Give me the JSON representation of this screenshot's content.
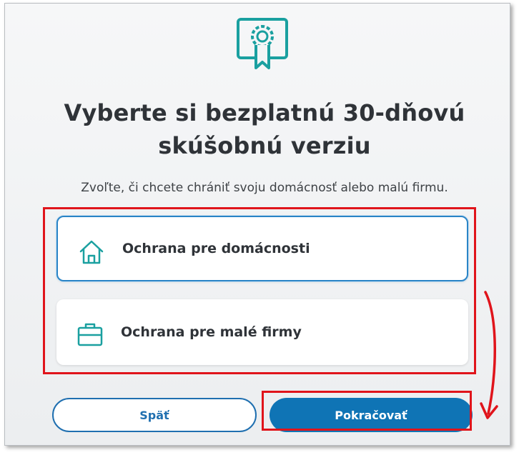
{
  "title": "Vyberte si bezplatnú 30-dňovú skúšobnú verziu",
  "subtitle": "Zvoľte, či chcete chrániť svoju domácnosť alebo malú firmu.",
  "icons": {
    "hero": "certificate-ribbon-icon",
    "home": "house-icon",
    "business": "briefcase-icon"
  },
  "options": [
    {
      "label": "Ochrana pre domácnosti",
      "icon": "house-icon",
      "selected": true
    },
    {
      "label": "Ochrana pre malé firmy",
      "icon": "briefcase-icon",
      "selected": false
    }
  ],
  "buttons": {
    "back_label": "Späť",
    "continue_label": "Pokračovať"
  },
  "colors": {
    "accent": "#0f74b5",
    "icon_teal": "#1aa0a0",
    "annotation_red": "#e0141b",
    "title_text": "#2f3338"
  }
}
